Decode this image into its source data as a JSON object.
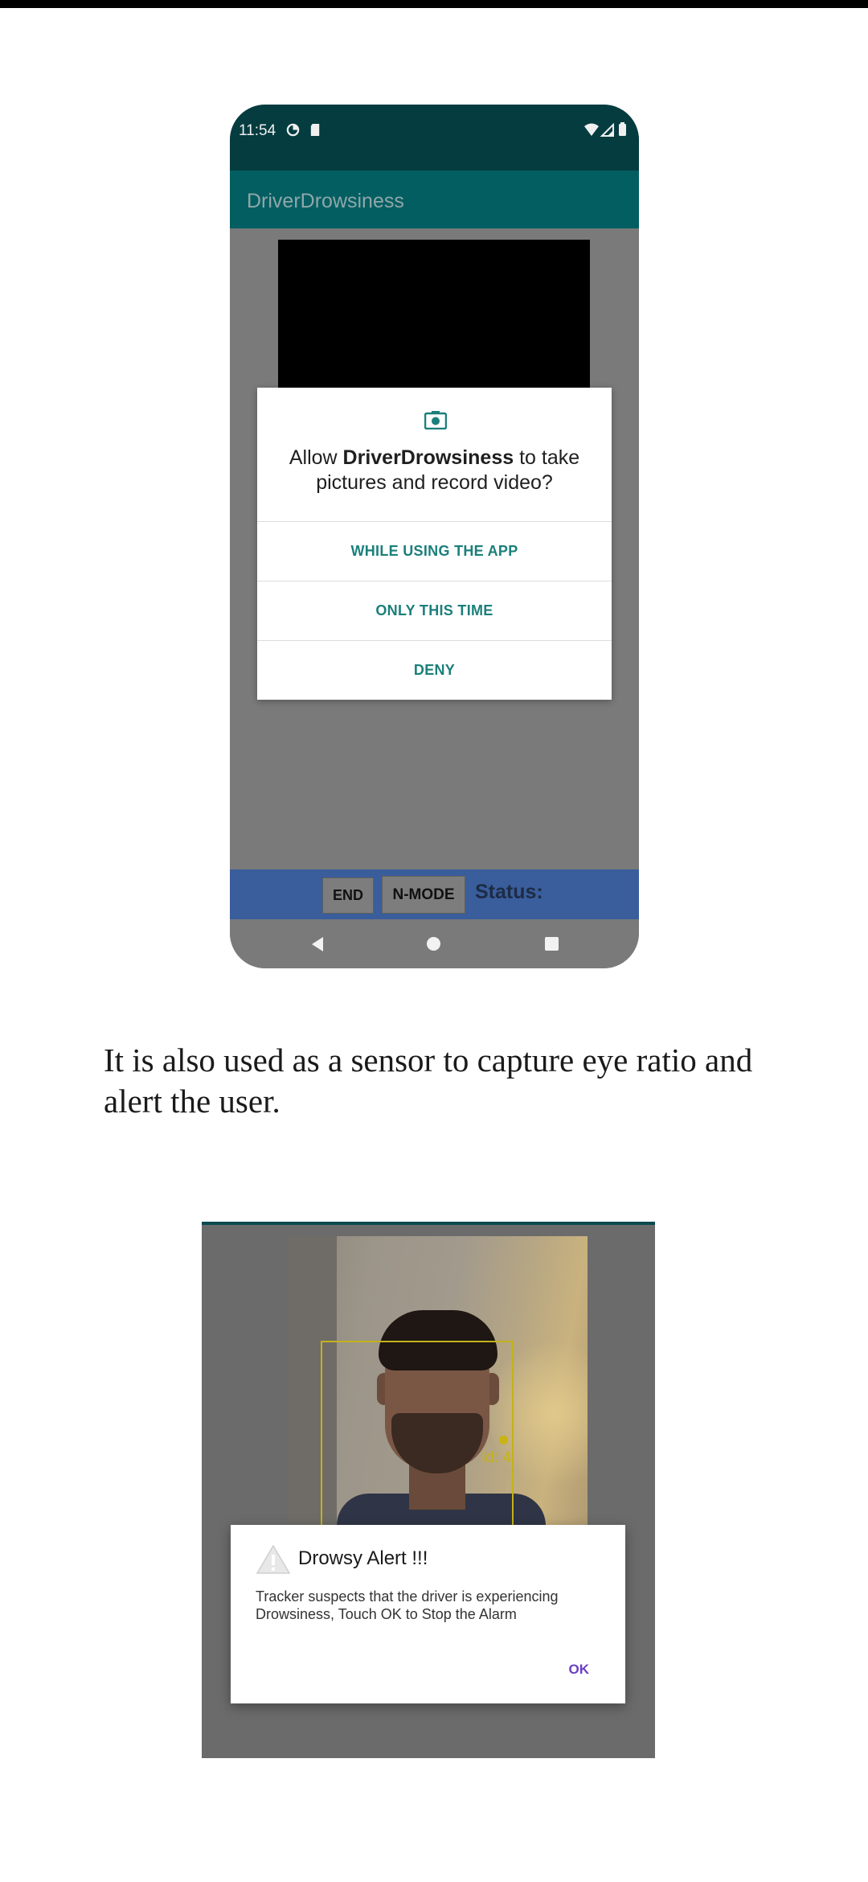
{
  "phone1": {
    "status_time": "11:54",
    "app_title": "DriverDrowsiness",
    "permission_dialog": {
      "question_prefix": "Allow ",
      "app_name": "DriverDrowsiness",
      "question_suffix": " to take pictures and record video?",
      "options": [
        "WHILE USING THE APP",
        "ONLY THIS TIME",
        "DENY"
      ]
    },
    "bottom_bar": {
      "end_label": "END",
      "nmode_label": "N-MODE",
      "status_label": "Status:"
    }
  },
  "paragraph": "It is also used as a sensor to capture eye ratio and alert the user.",
  "shot2": {
    "tracker_label": "Id: 4",
    "alert": {
      "title": "Drowsy Alert !!!",
      "message": "Tracker suspects that the driver is experiencing Drowsiness, Touch OK to Stop the Alarm",
      "ok_label": "OK"
    }
  },
  "colors": {
    "status_bar": "#043c40",
    "app_bar": "#035e62",
    "dialog_accent": "#1b7f7a",
    "bottom_bar": "#3a5d9c",
    "alert_ok": "#6a3fc4",
    "tracker": "#c3b21a"
  }
}
